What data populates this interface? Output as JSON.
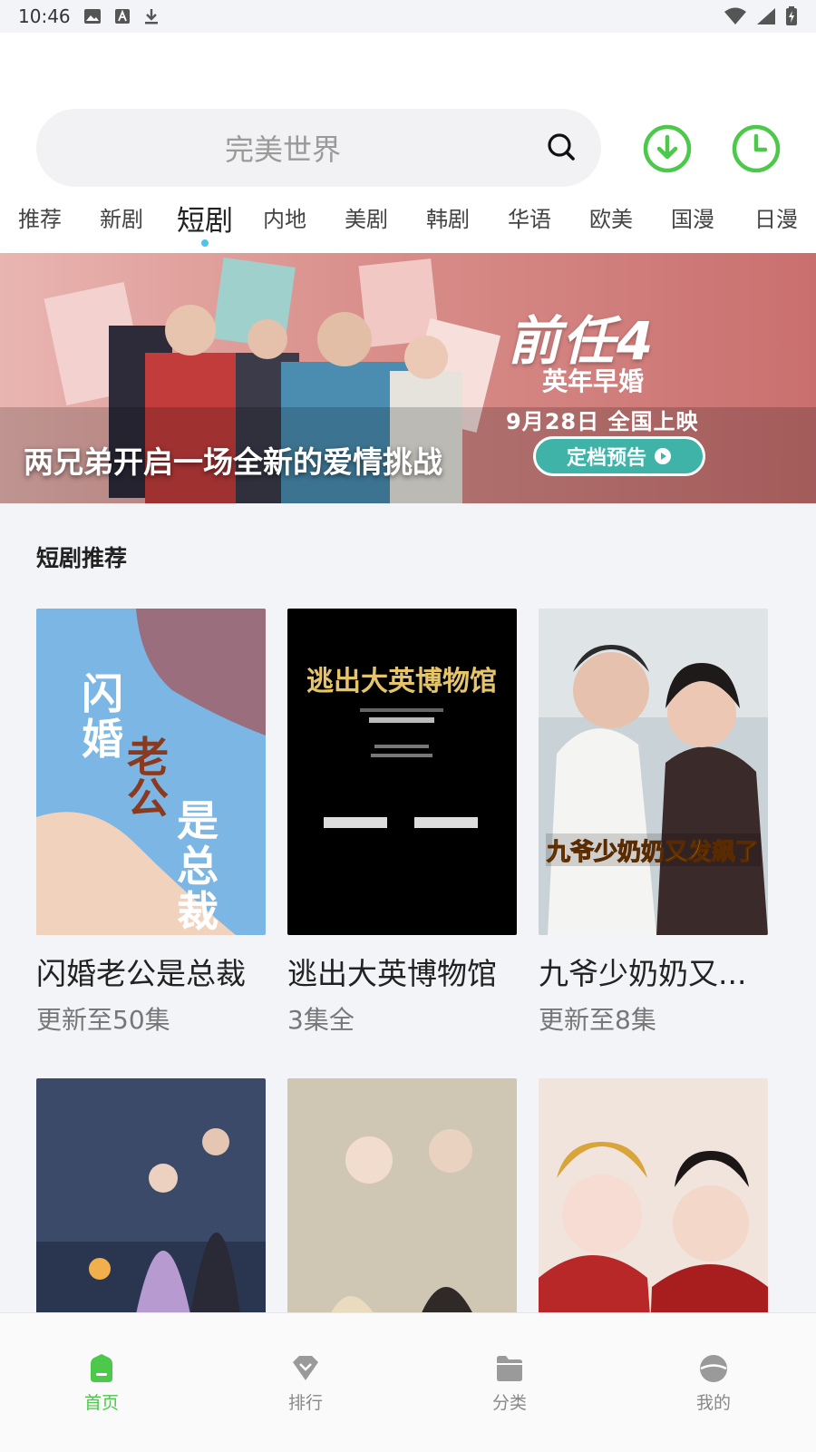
{
  "status_bar": {
    "time": "10:46"
  },
  "search": {
    "placeholder": "完美世界"
  },
  "tabs": [
    "推荐",
    "新剧",
    "短剧",
    "内地",
    "美剧",
    "韩剧",
    "华语",
    "欧美",
    "国漫",
    "日漫"
  ],
  "active_tab": "短剧",
  "banner": {
    "caption": "两兄弟开启一场全新的爱情挑战",
    "title": "前任4",
    "subtitle": "英年早婚",
    "date": "9月28日 全国上映",
    "button": "定档预告"
  },
  "section": {
    "title": "短剧推荐"
  },
  "cards": [
    {
      "title": "闪婚老公是总裁",
      "sub": "更新至50集"
    },
    {
      "title": "逃出大英博物馆",
      "sub": "3集全"
    },
    {
      "title": "九爷少奶奶又...",
      "sub": "更新至8集"
    }
  ],
  "nav": [
    {
      "label": "首页",
      "icon": "home-icon"
    },
    {
      "label": "排行",
      "icon": "ranking-icon"
    },
    {
      "label": "分类",
      "icon": "category-icon"
    },
    {
      "label": "我的",
      "icon": "profile-icon"
    }
  ],
  "colors": {
    "accent": "#4cc84a",
    "tab_dot": "#4fc3e8"
  }
}
